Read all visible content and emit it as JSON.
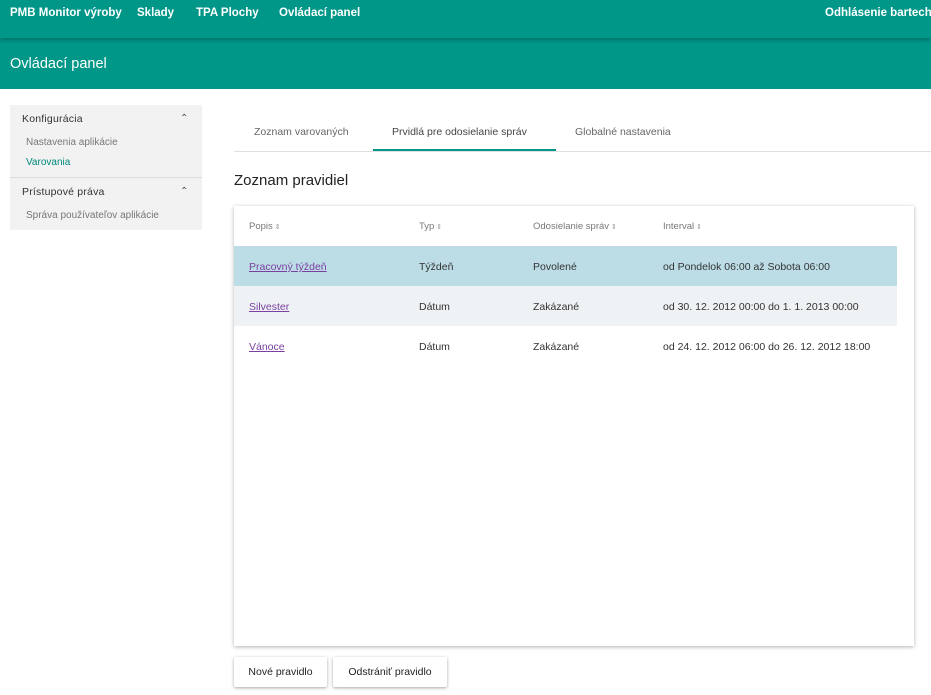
{
  "topnav": {
    "items": [
      "PMB Monitor výroby",
      "Sklady",
      "TPA Plochy",
      "Ovládací panel"
    ],
    "logout": "Odhlásenie bartech"
  },
  "subheader": {
    "title": "Ovládací panel"
  },
  "sidebar": {
    "sections": [
      {
        "title": "Konfigurácia",
        "items": [
          "Nastavenia aplikácie",
          "Varovania"
        ],
        "active_item": "Varovania",
        "chevron_icon": "chevron-up-icon"
      },
      {
        "title": "Prístupové práva",
        "items": [
          "Správa používateľov aplikácie"
        ],
        "chevron_icon": "chevron-up-icon"
      }
    ]
  },
  "tabs": {
    "items": [
      "Zoznam varovaných",
      "Prvidlá pre odosielanie správ",
      "Globalné nastavenia"
    ],
    "active": "Prvidlá pre odosielanie správ"
  },
  "main": {
    "title": "Zoznam pravidiel"
  },
  "table": {
    "headers": [
      "Popis",
      "Typ",
      "Odosielanie správ",
      "Interval"
    ],
    "sort_icon": "sort-icon",
    "rows": [
      {
        "popis": "Pracovný týždeň",
        "typ": "Týždeň",
        "odosielanie": "Povolené",
        "interval": "od Pondelok 06:00 až Sobota 06:00",
        "selected": true
      },
      {
        "popis": "Silvester",
        "typ": "Dátum",
        "odosielanie": "Zakázané",
        "interval": "od 30. 12. 2012 00:00 do 1. 1. 2013 00:00"
      },
      {
        "popis": "Vánoce",
        "typ": "Dátum",
        "odosielanie": "Zakázané",
        "interval": "od 24. 12. 2012 06:00 do 26. 12. 2012 18:00"
      }
    ]
  },
  "actions": {
    "new_rule": "Nové pravidlo",
    "delete_rule": "Odstrániť pravidlo"
  },
  "colors": {
    "primary": "#009688",
    "selected_row": "#bcdde6",
    "alt_row": "#eef2f4",
    "link": "#7b3fa0"
  }
}
